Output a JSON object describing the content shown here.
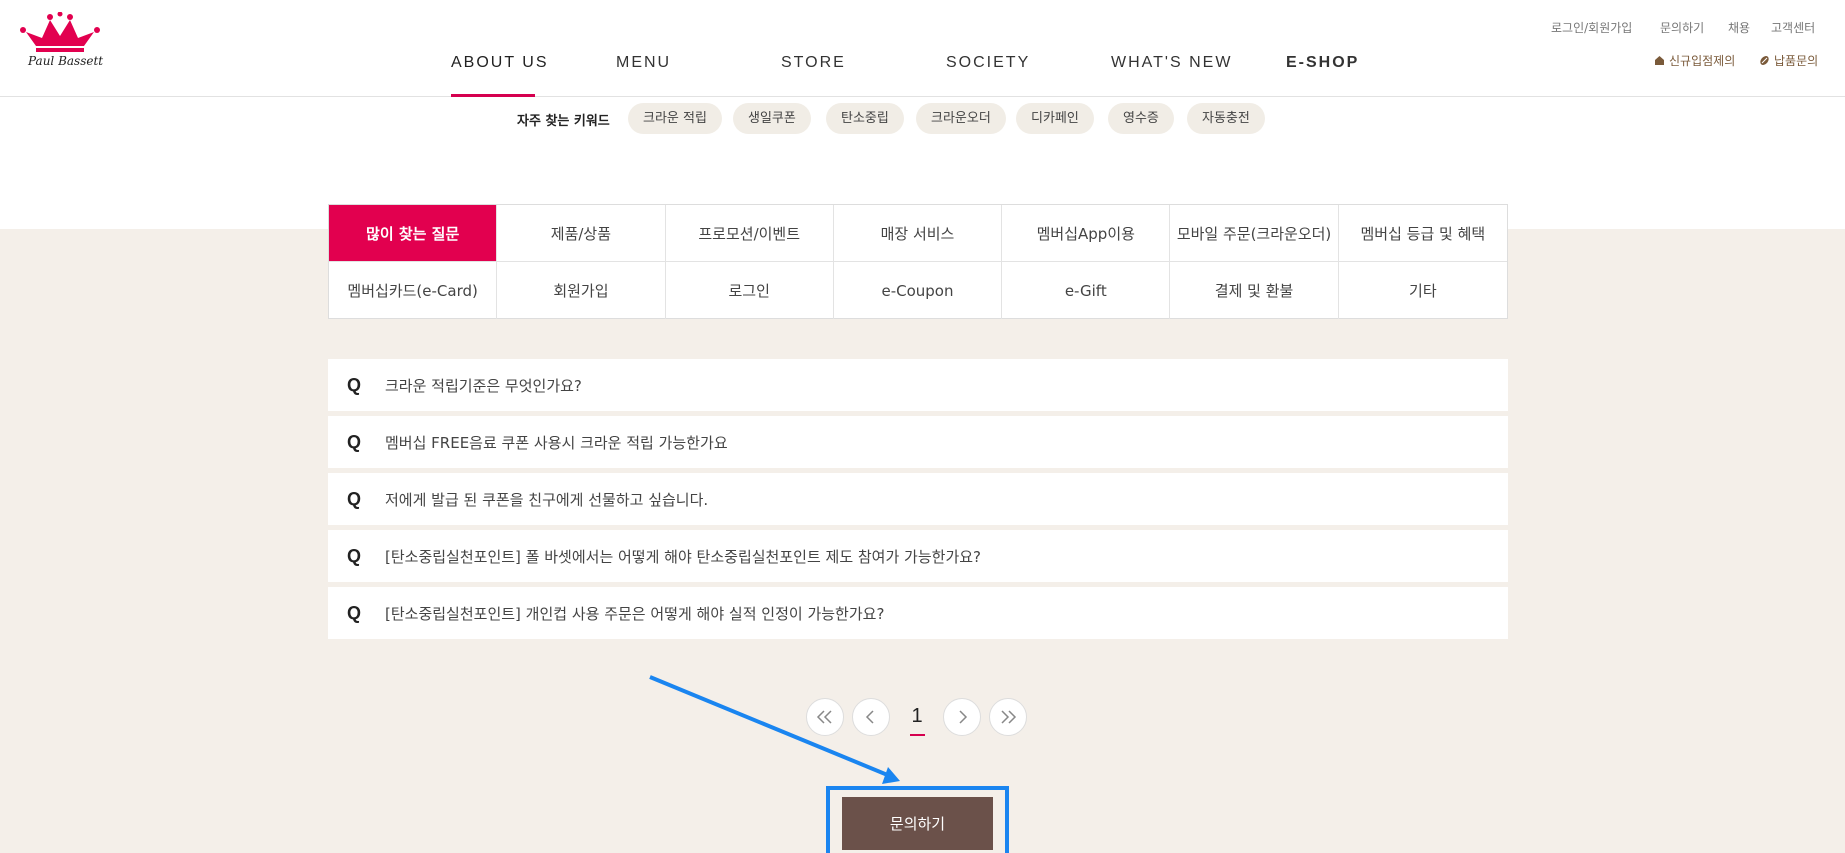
{
  "logo": {
    "brand": "Paul Bassett"
  },
  "gnb": [
    {
      "label": "ABOUT US"
    },
    {
      "label": "MENU"
    },
    {
      "label": "STORE"
    },
    {
      "label": "SOCIETY"
    },
    {
      "label": "WHAT'S NEW"
    },
    {
      "label": "E-SHOP"
    }
  ],
  "util": {
    "login": "로그인/회원가입",
    "inquiry": "문의하기",
    "recruit": "채용",
    "customer_center": "고객센터",
    "new_store": "신규입점제의",
    "supply": "납품문의"
  },
  "keywords": {
    "label": "자주 찾는 키워드",
    "items": [
      "크라운 적립",
      "생일쿠폰",
      "탄소중립",
      "크라운오더",
      "디카페인",
      "영수증",
      "자동충전"
    ]
  },
  "categories": [
    "많이 찾는 질문",
    "제품/상품",
    "프로모션/이벤트",
    "매장 서비스",
    "멤버십App이용",
    "모바일 주문(크라운오더)",
    "멤버십 등급 및 혜택",
    "멤버십카드(e-Card)",
    "회원가입",
    "로그인",
    "e-Coupon",
    "e-Gift",
    "결제 및 환불",
    "기타"
  ],
  "faq": {
    "q_label": "Q",
    "items": [
      "크라운 적립기준은 무엇인가요?",
      "멤버십 FREE음료 쿠폰 사용시 크라운 적립 가능한가요",
      "저에게 발급 된 쿠폰을 친구에게 선물하고 싶습니다.",
      "[탄소중립실천포인트] 폴 바셋에서는 어떻게 해야 탄소중립실천포인트 제도 참여가 가능한가요?",
      "[탄소중립실천포인트] 개인컵 사용 주문은 어떻게 해야 실적 인정이 가능한가요?"
    ]
  },
  "pagination": {
    "current": "1"
  },
  "inquiry_button": {
    "label": "문의하기"
  },
  "colors": {
    "accent": "#e2004f",
    "beige": "#f4efe9",
    "button": "#6b514a",
    "highlight": "#1a85f0"
  }
}
